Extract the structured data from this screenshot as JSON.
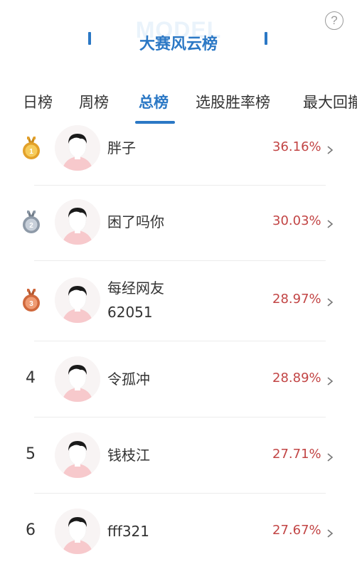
{
  "header": {
    "watermark": "MODEL",
    "title": "大赛风云榜",
    "help_icon": "question-circle-icon",
    "help_glyph": "?"
  },
  "tabs": [
    {
      "label": "日榜",
      "active": false
    },
    {
      "label": "周榜",
      "active": false
    },
    {
      "label": "总榜",
      "active": true
    },
    {
      "label": "选股胜率榜",
      "active": false
    },
    {
      "label": "最大回撤",
      "active": false
    }
  ],
  "list": [
    {
      "rank": "1",
      "medal": "gold-medal-icon",
      "name_lines": [
        "胖子"
      ],
      "percent": "36.16%"
    },
    {
      "rank": "2",
      "medal": "silver-medal-icon",
      "name_lines": [
        "困了吗你"
      ],
      "percent": "30.03%"
    },
    {
      "rank": "3",
      "medal": "bronze-medal-icon",
      "name_lines": [
        "每经网友",
        "62051"
      ],
      "percent": "28.97%"
    },
    {
      "rank": "4",
      "medal": "",
      "name_lines": [
        "令孤冲"
      ],
      "percent": "28.89%"
    },
    {
      "rank": "5",
      "medal": "",
      "name_lines": [
        "钱枝江"
      ],
      "percent": "27.71%"
    },
    {
      "rank": "6",
      "medal": "",
      "name_lines": [
        "fff321"
      ],
      "percent": "27.67%"
    }
  ],
  "colors": {
    "accent": "#2b78c5",
    "percent": "#c24545",
    "gold": "#e3a12a",
    "silver": "#8e9aa8",
    "bronze": "#d0683c"
  }
}
